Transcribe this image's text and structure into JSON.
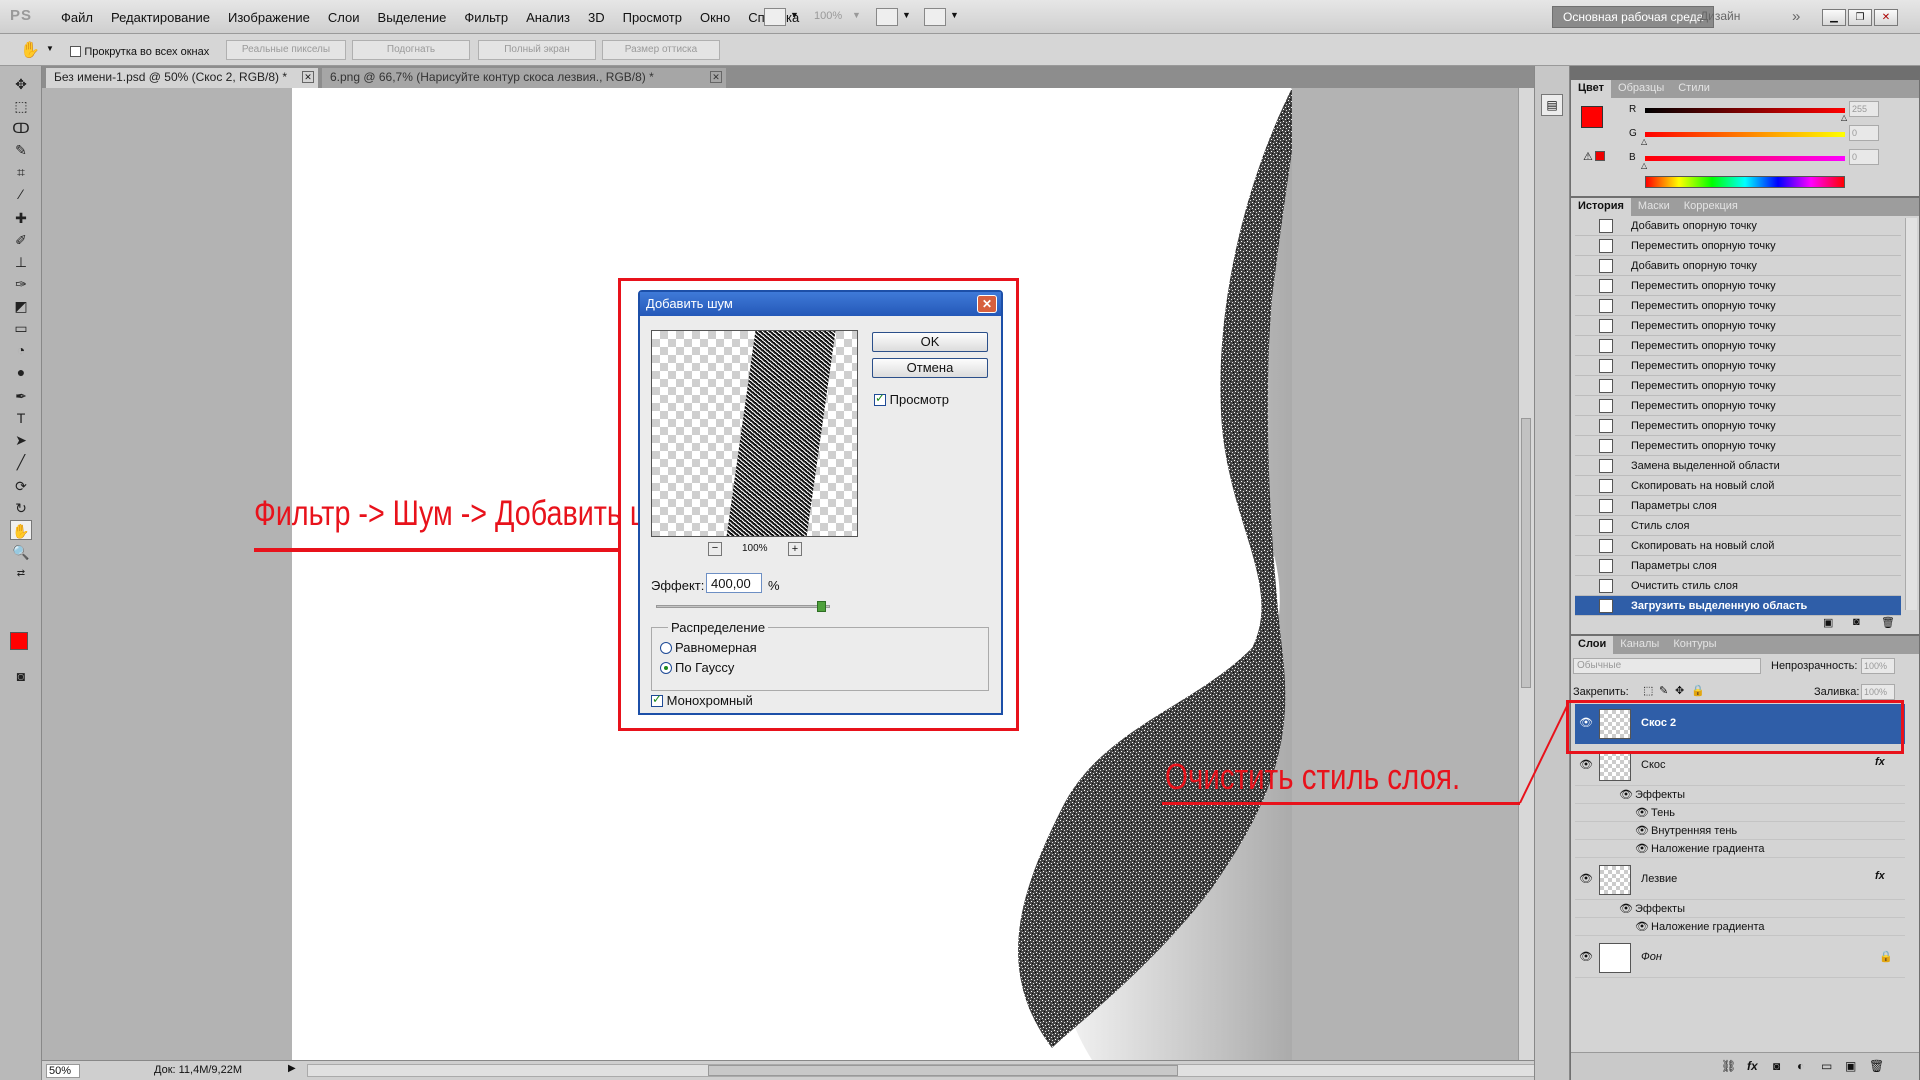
{
  "app": {
    "logo": "PS",
    "menu": [
      "Файл",
      "Редактирование",
      "Изображение",
      "Слои",
      "Выделение",
      "Фильтр",
      "Анализ",
      "3D",
      "Просмотр",
      "Окно",
      "Справка"
    ],
    "zoom_combo": "100%",
    "workspace_main": "Основная рабочая среда",
    "workspace_design": "Дизайн",
    "more": "»"
  },
  "options": {
    "scroll_all_label": "Прокрутка во всех окнах",
    "buttons": [
      "Реальные пикселы",
      "Подогнать",
      "Полный экран",
      "Размер оттиска"
    ]
  },
  "tabs": [
    {
      "label": "Без имени-1.psd @ 50% (Скос 2, RGB/8) *"
    },
    {
      "label": "6.png @ 66,7% (Нарисуйте контур скоса лезвия., RGB/8) *"
    }
  ],
  "status": {
    "zoom": "50%",
    "doc": "Док: 11,4M/9,22M"
  },
  "dialog": {
    "title": "Добавить шум",
    "ok": "OK",
    "cancel": "Отмена",
    "preview_label": "Просмотр",
    "zoom": "100%",
    "minus": "−",
    "plus": "+",
    "effect_label": "Эффект:",
    "effect_value": "400,00",
    "percent": "%",
    "effect_fraction": 0.95,
    "distribution_label": "Распределение",
    "uniform": "Равномерная",
    "gaussian": "По Гауссу",
    "mono": "Монохромный"
  },
  "annotations": {
    "filter_path": "Фильтр -> Шум -> Добавить шум.",
    "clear_style": "Очистить стиль слоя."
  },
  "color_panel": {
    "tabs": [
      "Цвет",
      "Образцы",
      "Стили"
    ],
    "channels": [
      {
        "name": "R",
        "value": "255",
        "fraction": 1.0
      },
      {
        "name": "G",
        "value": "0",
        "fraction": 0.0
      },
      {
        "name": "B",
        "value": "0",
        "fraction": 0.0
      }
    ],
    "foreground": "#ff0000",
    "background": "#ffffff"
  },
  "history_panel": {
    "tabs": [
      "История",
      "Маски",
      "Коррекция"
    ],
    "items": [
      "Добавить опорную точку",
      "Переместить опорную точку",
      "Добавить опорную точку",
      "Переместить опорную точку",
      "Переместить опорную точку",
      "Переместить опорную точку",
      "Переместить опорную точку",
      "Переместить опорную точку",
      "Переместить опорную точку",
      "Переместить опорную точку",
      "Переместить опорную точку",
      "Переместить опорную точку",
      "Замена выделенной области",
      "Скопировать на новый слой",
      "Параметры слоя",
      "Стиль слоя",
      "Скопировать на новый слой",
      "Параметры слоя",
      "Очистить стиль слоя",
      "Загрузить выделенную область"
    ],
    "selected_index": 19
  },
  "layers_panel": {
    "tabs": [
      "Слои",
      "Каналы",
      "Контуры"
    ],
    "blend_mode": "Обычные",
    "opacity_label": "Непрозрачность:",
    "opacity_value": "100%",
    "lock_label": "Закрепить:",
    "fill_label": "Заливка:",
    "fill_value": "100%",
    "fx": "fx",
    "layers": [
      {
        "name": "Скос 2",
        "selected": true
      },
      {
        "name": "Скос",
        "effects_label": "Эффекты",
        "effects": [
          "Тень",
          "Внутренняя тень",
          "Наложение градиента"
        ]
      },
      {
        "name": "Лезвие",
        "effects_label": "Эффекты",
        "effects": [
          "Наложение градиента"
        ]
      },
      {
        "name": "Фон",
        "locked": true
      }
    ]
  },
  "colors": {
    "accent": "#2f5ea8",
    "annotation_red": "#e8121b",
    "dialog_title": "#2458b8"
  }
}
